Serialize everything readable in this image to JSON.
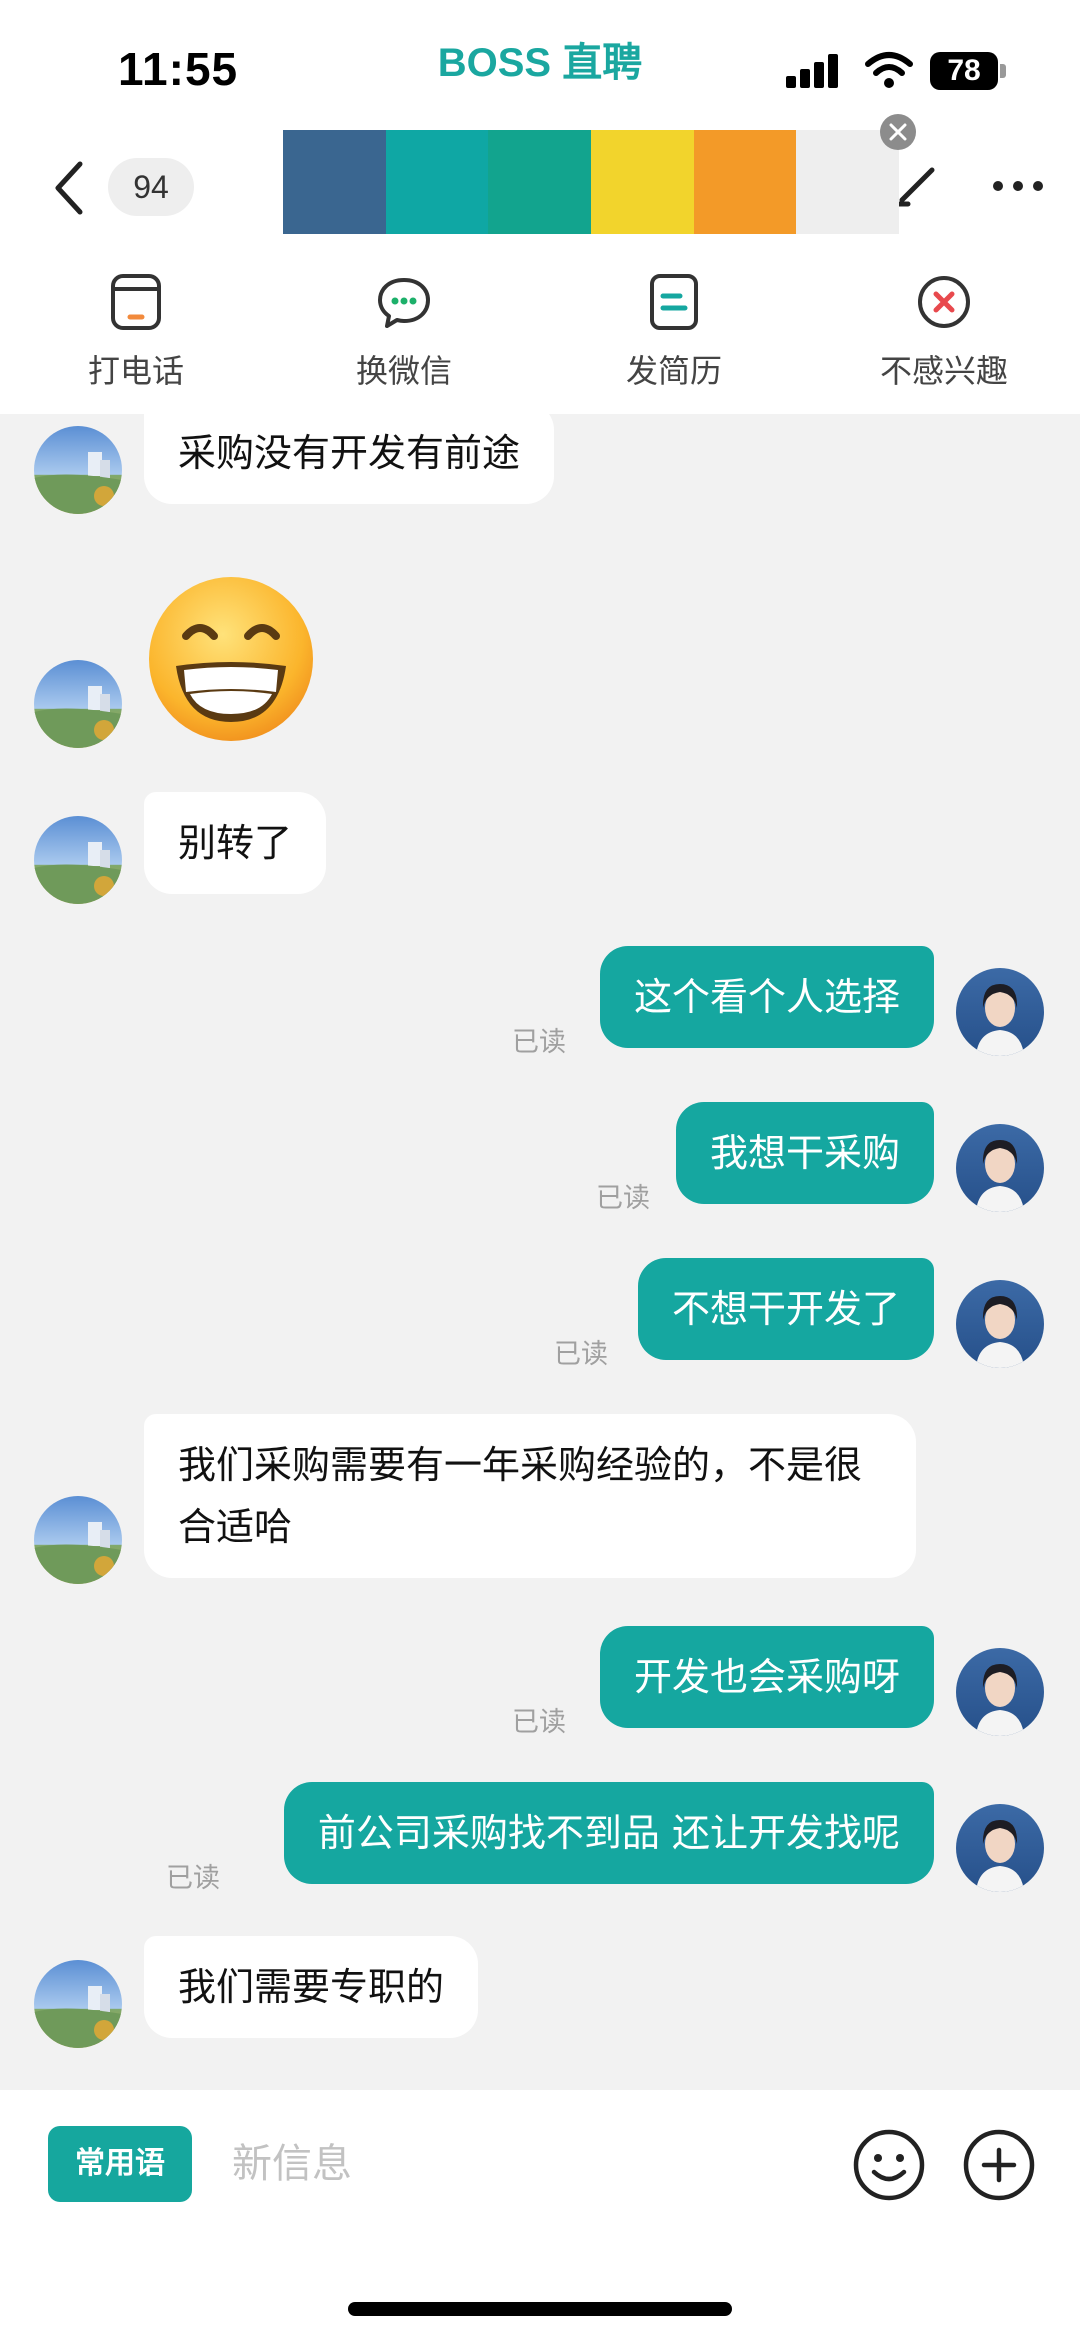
{
  "status_bar": {
    "time": "11:55",
    "app_name": "BOSS 直聘",
    "battery": "78"
  },
  "header": {
    "unread_count": "94",
    "banner_colors": [
      "#3a6690",
      "#0fa7a4",
      "#12a48e",
      "#f2d42c",
      "#f39a28",
      "#eeeeee"
    ]
  },
  "actions": [
    {
      "label": "打电话",
      "icon": "phone-icon"
    },
    {
      "label": "换微信",
      "icon": "wechat-icon"
    },
    {
      "label": "发简历",
      "icon": "resume-icon"
    },
    {
      "label": "不感兴趣",
      "icon": "not-interested-icon"
    }
  ],
  "messages": [
    {
      "side": "in",
      "text": "采购没有开发有前途"
    },
    {
      "side": "in",
      "emoji": "grinning-face-emoji"
    },
    {
      "side": "in",
      "text": "别转了"
    },
    {
      "side": "out",
      "text": "这个看个人选择",
      "status": "已读"
    },
    {
      "side": "out",
      "text": "我想干采购",
      "status": "已读"
    },
    {
      "side": "out",
      "text": "不想干开发了",
      "status": "已读"
    },
    {
      "side": "in",
      "text": "我们采购需要有一年采购经验的，不是很合适哈"
    },
    {
      "side": "out",
      "text": "开发也会采购呀",
      "status": "已读"
    },
    {
      "side": "out",
      "text": "前公司采购找不到品 还让开发找呢",
      "status": "已读"
    },
    {
      "side": "in",
      "text": "我们需要专职的"
    }
  ],
  "input_bar": {
    "phrases_label": "常用语",
    "placeholder": "新信息"
  },
  "colors": {
    "accent": "#15a7a0",
    "incoming_bubble": "#ffffff",
    "chat_bg": "#f2f2f2"
  }
}
